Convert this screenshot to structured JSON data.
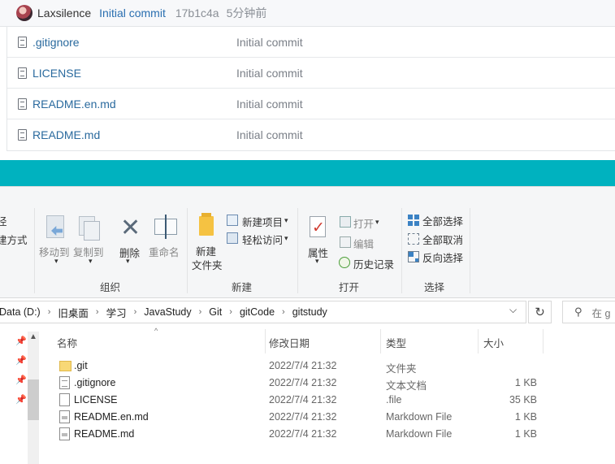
{
  "git": {
    "author": "Laxsilence",
    "commit_message": "Initial commit",
    "hash": "17b1c4a",
    "time": "5分钟前",
    "files": [
      {
        "name": ".gitignore",
        "commit": "Initial commit"
      },
      {
        "name": "LICENSE",
        "commit": "Initial commit"
      },
      {
        "name": "README.en.md",
        "commit": "Initial commit"
      },
      {
        "name": "README.md",
        "commit": "Initial commit"
      }
    ]
  },
  "ribbon": {
    "cut_labels": [
      "径",
      "建方式"
    ],
    "organize": {
      "group_label": "组织",
      "move_to": "移动到",
      "copy_to": "复制到",
      "delete": "删除",
      "rename": "重命名"
    },
    "new": {
      "group_label": "新建",
      "new_folder_line1": "新建",
      "new_folder_line2": "文件夹",
      "new_item": "新建项目",
      "easy_access": "轻松访问"
    },
    "open": {
      "group_label": "打开",
      "properties": "属性",
      "open": "打开",
      "edit": "编辑",
      "history": "历史记录"
    },
    "select": {
      "group_label": "选择",
      "select_all": "全部选择",
      "select_none": "全部取消",
      "invert": "反向选择"
    }
  },
  "address": {
    "crumbs": [
      "Data (D:)",
      "旧桌面",
      "学习",
      "JavaStudy",
      "Git",
      "gitCode",
      "gitstudy"
    ],
    "search_placeholder": "在 g"
  },
  "list": {
    "columns": {
      "name": "名称",
      "date": "修改日期",
      "type": "类型",
      "size": "大小"
    },
    "rows": [
      {
        "name": ".git",
        "date": "2022/7/4 21:32",
        "type": "文件夹",
        "size": "",
        "icon": "folder-icon"
      },
      {
        "name": ".gitignore",
        "date": "2022/7/4 21:32",
        "type": "文本文档",
        "size": "1 KB",
        "icon": "text-file-icon"
      },
      {
        "name": "LICENSE",
        "date": "2022/7/4 21:32",
        "type": ".file",
        "size": "35 KB",
        "icon": "blank-file-icon"
      },
      {
        "name": "README.en.md",
        "date": "2022/7/4 21:32",
        "type": "Markdown File",
        "size": "1 KB",
        "icon": "markdown-file-icon"
      },
      {
        "name": "README.md",
        "date": "2022/7/4 21:32",
        "type": "Markdown File",
        "size": "1 KB",
        "icon": "markdown-file-icon"
      }
    ]
  },
  "colors": {
    "accent_teal": "#00b2bf",
    "link_blue": "#2a6a9e",
    "ribbon_bg": "#f5f6f7"
  }
}
